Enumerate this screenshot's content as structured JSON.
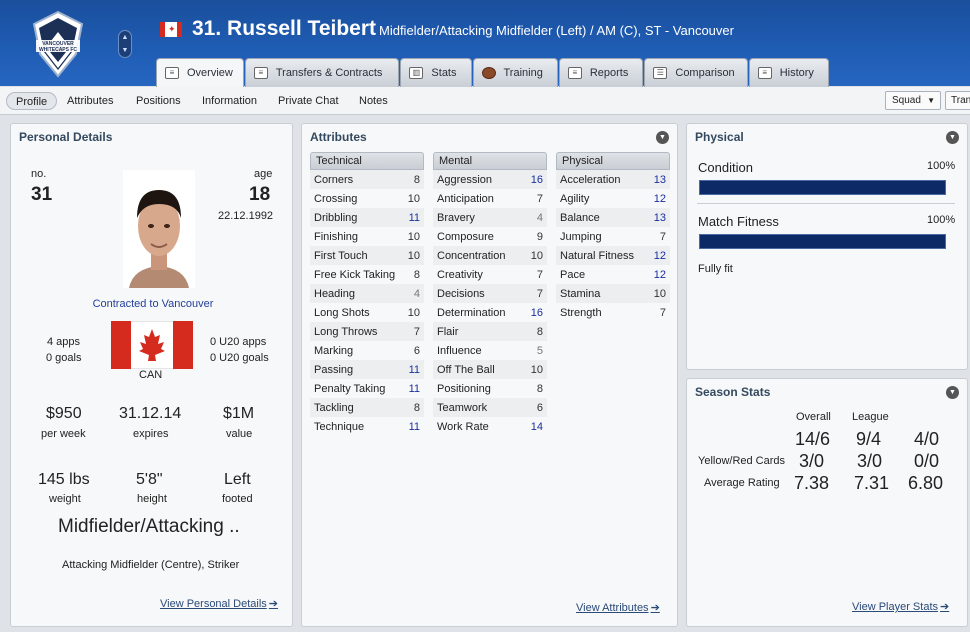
{
  "header": {
    "club_crest_text": "VANCOUVER WHITECAPS FC",
    "player_name": "31. Russell Teibert",
    "player_description": "Midfielder/Attacking Midfielder (Left) / AM (C), ST - Vancouver"
  },
  "tabs": [
    {
      "label": "Overview",
      "active": true
    },
    {
      "label": "Transfers & Contracts"
    },
    {
      "label": "Stats"
    },
    {
      "label": "Training"
    },
    {
      "label": "Reports"
    },
    {
      "label": "Comparison"
    },
    {
      "label": "History"
    }
  ],
  "subnav": {
    "items": [
      "Profile",
      "Attributes",
      "Positions",
      "Information",
      "Private Chat",
      "Notes"
    ],
    "squad_label": "Squad",
    "transfer_label": "Tran"
  },
  "personal": {
    "title": "Personal Details",
    "no_label": "no.",
    "no_value": "31",
    "age_label": "age",
    "age_value": "18",
    "dob": "22.12.1992",
    "contract": "Contracted to Vancouver",
    "apps": "4 apps",
    "goals": "0 goals",
    "u20_apps": "0 U20 apps",
    "u20_goals": "0 U20 goals",
    "nation": "CAN",
    "wage": "$950",
    "wage_label": "per week",
    "expires": "31.12.14",
    "expires_label": "expires",
    "value": "$1M",
    "value_label": "value",
    "weight": "145 lbs",
    "weight_label": "weight",
    "height": "5'8\"",
    "height_label": "height",
    "foot": "Left",
    "foot_label": "footed",
    "position_big": "Midfielder/Attacking ..",
    "position_small": "Attacking Midfielder (Centre), Striker",
    "link": "View Personal Details"
  },
  "attributes": {
    "title": "Attributes",
    "technical_label": "Technical",
    "mental_label": "Mental",
    "physical_label": "Physical",
    "technical": [
      {
        "name": "Corners",
        "value": "8",
        "color": "#333333"
      },
      {
        "name": "Crossing",
        "value": "10",
        "color": "#333333"
      },
      {
        "name": "Dribbling",
        "value": "11",
        "color": "#1a2fa0"
      },
      {
        "name": "Finishing",
        "value": "10",
        "color": "#333333"
      },
      {
        "name": "First Touch",
        "value": "10",
        "color": "#333333"
      },
      {
        "name": "Free Kick Taking",
        "value": "8",
        "color": "#333333"
      },
      {
        "name": "Heading",
        "value": "4",
        "color": "#777777"
      },
      {
        "name": "Long Shots",
        "value": "10",
        "color": "#333333"
      },
      {
        "name": "Long Throws",
        "value": "7",
        "color": "#333333"
      },
      {
        "name": "Marking",
        "value": "6",
        "color": "#333333"
      },
      {
        "name": "Passing",
        "value": "11",
        "color": "#1a2fa0"
      },
      {
        "name": "Penalty Taking",
        "value": "11",
        "color": "#1a2fa0"
      },
      {
        "name": "Tackling",
        "value": "8",
        "color": "#333333"
      },
      {
        "name": "Technique",
        "value": "11",
        "color": "#1a2fa0"
      }
    ],
    "mental": [
      {
        "name": "Aggression",
        "value": "16",
        "color": "#1a2fa0"
      },
      {
        "name": "Anticipation",
        "value": "7",
        "color": "#333333"
      },
      {
        "name": "Bravery",
        "value": "4",
        "color": "#777777"
      },
      {
        "name": "Composure",
        "value": "9",
        "color": "#333333"
      },
      {
        "name": "Concentration",
        "value": "10",
        "color": "#333333"
      },
      {
        "name": "Creativity",
        "value": "7",
        "color": "#333333"
      },
      {
        "name": "Decisions",
        "value": "7",
        "color": "#333333"
      },
      {
        "name": "Determination",
        "value": "16",
        "color": "#1a2fa0"
      },
      {
        "name": "Flair",
        "value": "8",
        "color": "#333333"
      },
      {
        "name": "Influence",
        "value": "5",
        "color": "#777777"
      },
      {
        "name": "Off The Ball",
        "value": "10",
        "color": "#333333"
      },
      {
        "name": "Positioning",
        "value": "8",
        "color": "#333333"
      },
      {
        "name": "Teamwork",
        "value": "6",
        "color": "#333333"
      },
      {
        "name": "Work Rate",
        "value": "14",
        "color": "#1a2fa0"
      }
    ],
    "physical": [
      {
        "name": "Acceleration",
        "value": "13",
        "color": "#1a2fa0"
      },
      {
        "name": "Agility",
        "value": "12",
        "color": "#1a2fa0"
      },
      {
        "name": "Balance",
        "value": "13",
        "color": "#1a2fa0"
      },
      {
        "name": "Jumping",
        "value": "7",
        "color": "#333333"
      },
      {
        "name": "Natural Fitness",
        "value": "12",
        "color": "#1a2fa0"
      },
      {
        "name": "Pace",
        "value": "12",
        "color": "#1a2fa0"
      },
      {
        "name": "Stamina",
        "value": "10",
        "color": "#333333"
      },
      {
        "name": "Strength",
        "value": "7",
        "color": "#333333"
      }
    ],
    "link": "View Attributes"
  },
  "physical": {
    "title": "Physical",
    "condition_label": "Condition",
    "condition_value": "100%",
    "condition_level": 1.0,
    "fitness_label": "Match Fitness",
    "fitness_value": "100%",
    "fitness_level": 1.0,
    "status": "Fully fit"
  },
  "season": {
    "title": "Season Stats",
    "col_overall": "Overall",
    "col_league": "League",
    "apps_row": [
      "14/6",
      "9/4",
      "4/0"
    ],
    "cards_label": "Yellow/Red Cards",
    "cards_row": [
      "3/0",
      "3/0",
      "0/0"
    ],
    "rating_label": "Average Rating",
    "rating_row": [
      "7.38",
      "7.31",
      "6.80"
    ],
    "link": "View Player Stats"
  }
}
